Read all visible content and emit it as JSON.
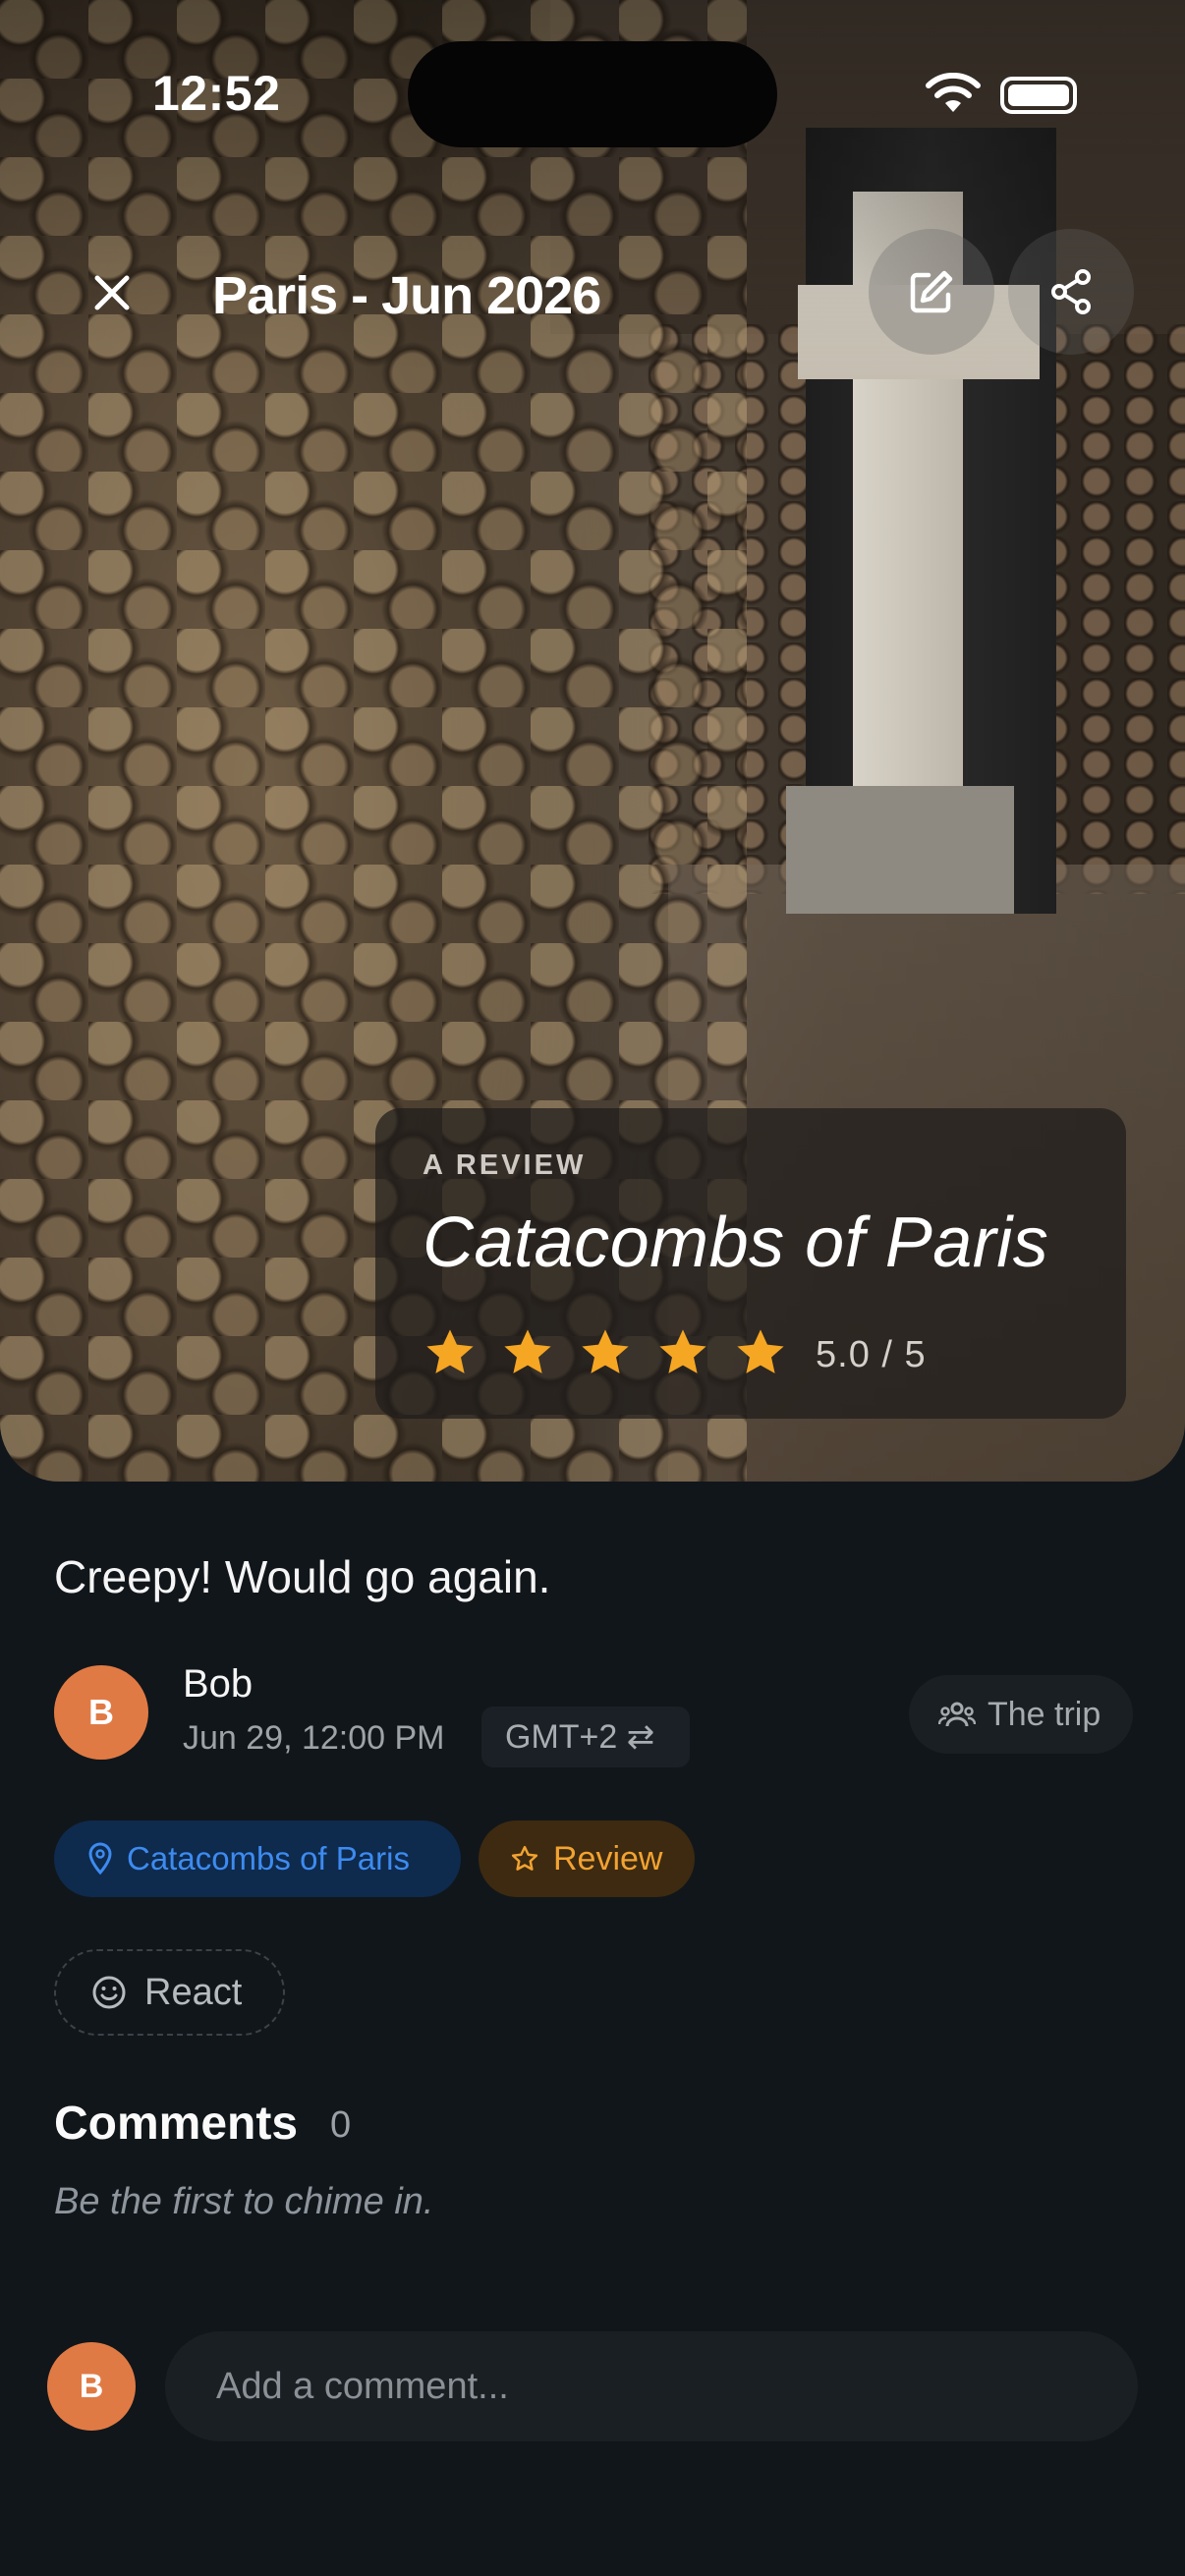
{
  "status_bar": {
    "time": "12:52"
  },
  "header": {
    "trip_title": "Paris - Jun 2026"
  },
  "review_card": {
    "kicker": "A REVIEW",
    "place": "Catacombs of Paris",
    "rating": 5.0,
    "rating_text": "5.0 / 5",
    "star_color": "#F5A623"
  },
  "post": {
    "body": "Creepy! Would go again.",
    "author": {
      "initial": "B",
      "name": "Bob",
      "avatar_color": "#E07A44"
    },
    "date": "Jun 29, 12:00 PM",
    "timezone": "GMT+2 ⇄",
    "trip_link": "The trip"
  },
  "tags": {
    "place": "Catacombs of Paris",
    "type": "Review"
  },
  "react_label": "React",
  "comments": {
    "title": "Comments",
    "count": "0",
    "empty_text": "Be the first to chime in."
  },
  "composer": {
    "initial": "B",
    "placeholder": "Add a comment..."
  }
}
